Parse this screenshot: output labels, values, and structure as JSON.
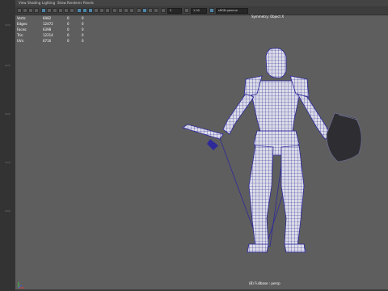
{
  "menu": {
    "items": [
      "View",
      "Shading",
      "Lighting",
      "Show",
      "Renderer",
      "Panels"
    ]
  },
  "toolbar": {
    "field_a": "0",
    "field_b": "1.00",
    "color_space": "sRGB gamma"
  },
  "hud": {
    "rows": [
      {
        "label": "Verts:",
        "a": "6082",
        "b": "0",
        "c": "0"
      },
      {
        "label": "Edges:",
        "a": "12472",
        "b": "0",
        "c": "0"
      },
      {
        "label": "Faces:",
        "a": "6398",
        "b": "0",
        "c": "0"
      },
      {
        "label": "Tris:",
        "a": "12214",
        "b": "0",
        "c": "0"
      },
      {
        "label": "UVs:",
        "a": "6716",
        "b": "0",
        "c": "0"
      }
    ]
  },
  "viewport": {
    "symmetry_label": "Symmetry: Object X",
    "camera_label": "(B) Fullbase : persp"
  },
  "colors": {
    "viewport_bg": "#5e5e5e",
    "wire_color": "#2e2a9a",
    "shaded_color": "#dcdce8",
    "highlight_icon": "#4d86a8"
  }
}
